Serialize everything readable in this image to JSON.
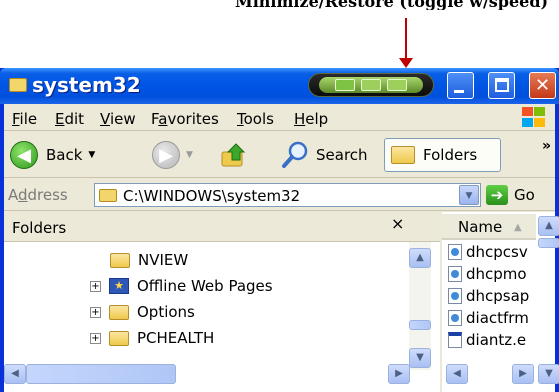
{
  "caption": "Minimize/Restore (toggle w/speed)",
  "window": {
    "title": "system32",
    "colors": {
      "titlebar": "#0055e5",
      "close": "#c33818",
      "frame": "#ece9d8",
      "arrow": "#c00000"
    }
  },
  "menu": {
    "items": [
      {
        "label": "File",
        "accel": "F",
        "rest": "ile"
      },
      {
        "label": "Edit",
        "accel": "E",
        "rest": "dit"
      },
      {
        "label": "View",
        "accel": "V",
        "rest": "iew"
      },
      {
        "label": "Favorites",
        "accel": "a",
        "pre": "F",
        "rest": "vorites"
      },
      {
        "label": "Tools",
        "accel": "T",
        "rest": "ools"
      },
      {
        "label": "Help",
        "accel": "H",
        "rest": "elp"
      }
    ]
  },
  "toolbar": {
    "back_label": "Back",
    "search_label": "Search",
    "folders_label": "Folders",
    "overflow": "»"
  },
  "address": {
    "label": "Address",
    "label_accel": "d",
    "value": "C:\\WINDOWS\\system32",
    "go_label": "Go"
  },
  "folders_pane": {
    "title": "Folders",
    "close_glyph": "×",
    "items": [
      {
        "label": "NVIEW",
        "expandable": false,
        "icon": "folder-icon"
      },
      {
        "label": "Offline Web Pages",
        "expandable": true,
        "icon": "offline-web-pages-icon"
      },
      {
        "label": "Options",
        "expandable": true,
        "icon": "folder-icon"
      },
      {
        "label": "PCHEALTH",
        "expandable": true,
        "icon": "folder-icon"
      }
    ]
  },
  "file_list": {
    "column": "Name",
    "files": [
      {
        "name": "dhcpcsv",
        "icon": "dll-file-icon"
      },
      {
        "name": "dhcpmo",
        "icon": "dll-file-icon"
      },
      {
        "name": "dhcpsap",
        "icon": "dll-file-icon"
      },
      {
        "name": "diactfrm",
        "icon": "dll-file-icon"
      },
      {
        "name": "diantz.e",
        "icon": "exe-file-icon"
      }
    ]
  }
}
